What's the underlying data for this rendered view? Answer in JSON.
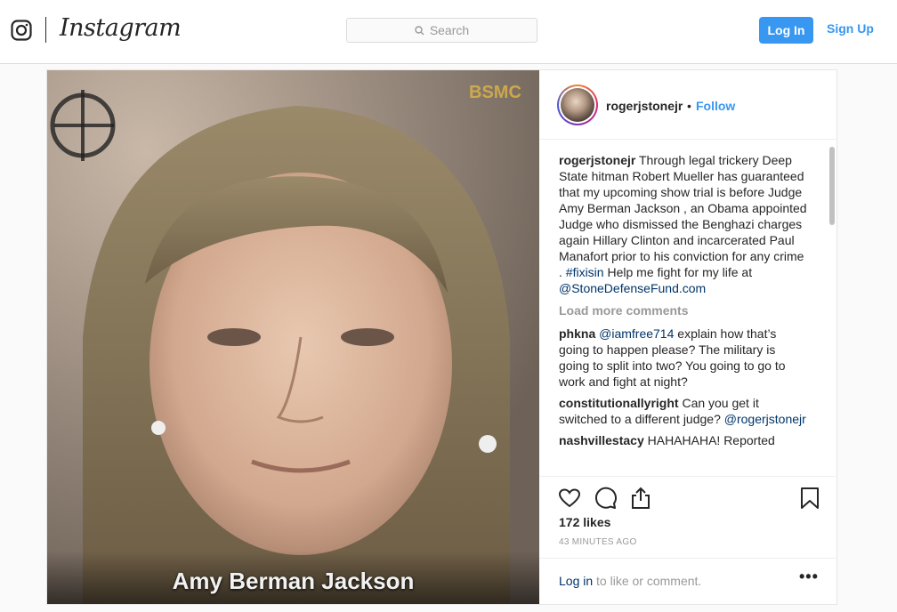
{
  "header": {
    "wordmark": "Instagram",
    "search_placeholder": "Search",
    "login_label": "Log In",
    "signup_label": "Sign Up"
  },
  "photo": {
    "caption": "Amy Berman Jackson",
    "watermark": "BSMC"
  },
  "post": {
    "username": "rogerjstonejr",
    "dot": "•",
    "follow_label": "Follow",
    "caption_user": "rogerjstonejr",
    "caption_text": "Through legal trickery Deep State hitman Robert Mueller has guaranteed that my upcoming show trial is before Judge Amy Berman Jackson , an Obama appointed Judge who dismissed the Benghazi charges again Hillary Clinton and incarcerated Paul Manafort prior to his conviction for any crime .",
    "hashtag": "#fixisin",
    "caption_tail": "Help me fight for my life at",
    "mention": "@StoneDefenseFund.com",
    "load_more": "Load more comments",
    "comments": [
      {
        "user": "phkna",
        "mention": "@iamfree714",
        "text": "explain how that’s going to happen please? The military is going to split into two? You going to go to work and fight at night?"
      },
      {
        "user": "constitutionallyright",
        "text": "Can you get it switched to a different judge?",
        "mention_after": "@rogerjstonejr"
      },
      {
        "user": "nashvillestacy",
        "text": "HAHAHAHA! Reported"
      }
    ],
    "likes": "172 likes",
    "timestamp": "43 MINUTES AGO",
    "login_link": "Log in",
    "login_suffix": "to like or comment.",
    "more": "•••"
  },
  "icons": [
    "instagram-camera-icon",
    "search-icon",
    "heart-icon",
    "comment-icon",
    "share-icon",
    "bookmark-icon",
    "more-options-icon"
  ]
}
